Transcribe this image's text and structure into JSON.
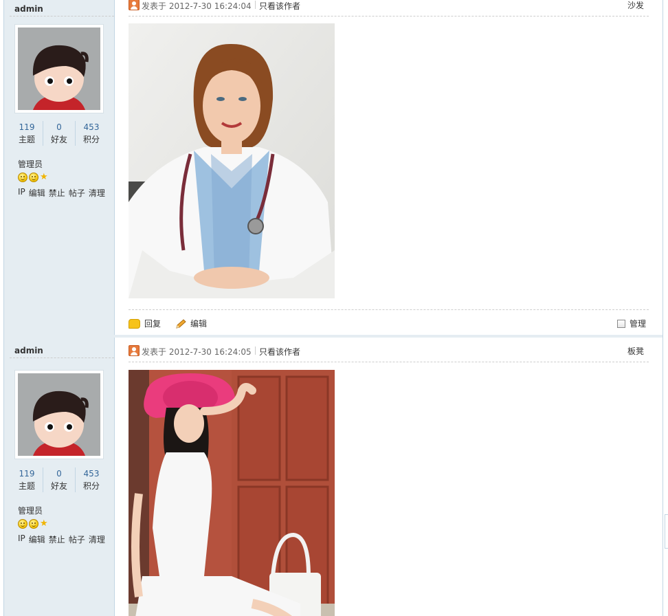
{
  "posts": [
    {
      "author": "admin",
      "stats": [
        {
          "num": "119",
          "label": "主题"
        },
        {
          "num": "0",
          "label": "好友"
        },
        {
          "num": "453",
          "label": "积分"
        }
      ],
      "usergroup": "管理员",
      "admin_links": [
        "IP",
        "编辑",
        "禁止",
        "帖子",
        "清理"
      ],
      "posted_at": "发表于 2012-7-30 16:24:04",
      "only_author": "只看该作者",
      "floor": "沙发",
      "reply_label": "回复",
      "edit_label": "编辑",
      "manage_label": "管理"
    },
    {
      "author": "admin",
      "stats": [
        {
          "num": "119",
          "label": "主题"
        },
        {
          "num": "0",
          "label": "好友"
        },
        {
          "num": "453",
          "label": "积分"
        }
      ],
      "usergroup": "管理员",
      "admin_links": [
        "IP",
        "编辑",
        "禁止",
        "帖子",
        "清理"
      ],
      "posted_at": "发表于 2012-7-30 16:24:05",
      "only_author": "只看该作者",
      "floor": "板凳"
    }
  ],
  "colors": {
    "sidebar_bg": "#e5edf2",
    "border": "#c2d5e3",
    "stat_number": "#336699"
  }
}
